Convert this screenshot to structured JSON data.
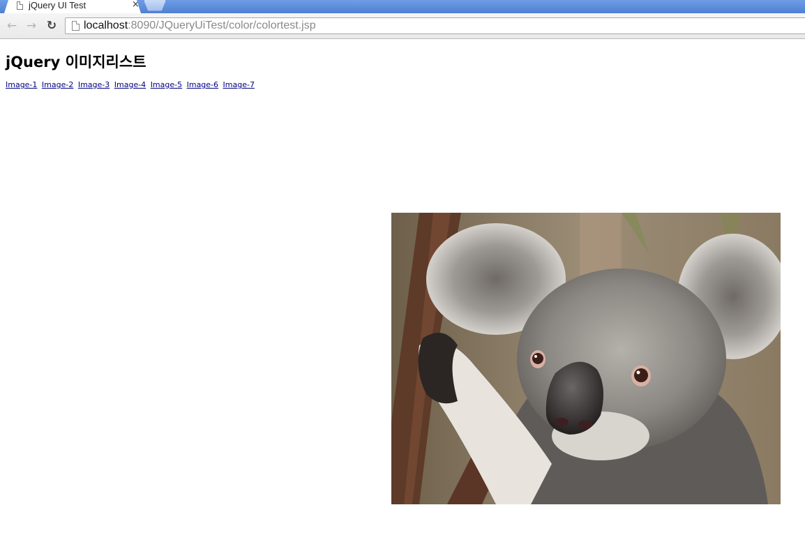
{
  "browser": {
    "tab_title": "jQuery UI Test",
    "tab_close_glyph": "×",
    "url_host": "localhost",
    "url_rest": ":8090/JQueryUiTest/color/colortest.jsp",
    "back_icon": "back-arrow-icon",
    "forward_icon": "forward-arrow-icon",
    "reload_icon": "reload-icon"
  },
  "page": {
    "heading": "jQuery 이미지리스트",
    "links": [
      "Image-1",
      "Image-2",
      "Image-3",
      "Image-4",
      "Image-5",
      "Image-6",
      "Image-7"
    ],
    "photo": {
      "subject": "koala",
      "link_color": "#000080"
    }
  }
}
